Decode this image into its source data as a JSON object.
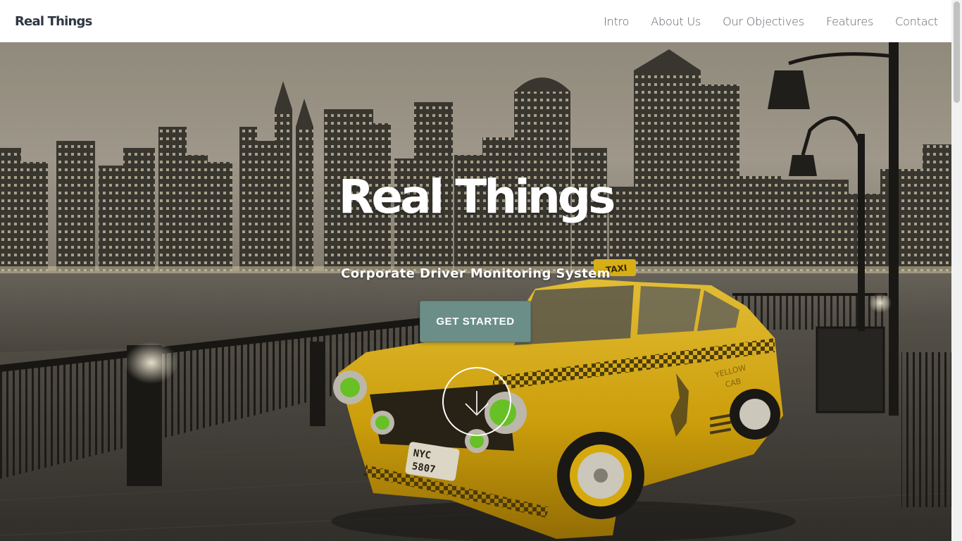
{
  "header": {
    "brand": "Real Things",
    "nav": [
      {
        "label": "Intro"
      },
      {
        "label": "About Us"
      },
      {
        "label": "Our Objectives"
      },
      {
        "label": "Features"
      },
      {
        "label": "Contact"
      }
    ]
  },
  "hero": {
    "title": "Real Things",
    "subtitle": "Corporate Driver Monitoring System",
    "cta_label": "GET STARTED",
    "scroll_icon": "arrow-down-icon",
    "image_text": {
      "taxi_sign": "TAXI",
      "plate_line1": "NYC",
      "plate_line2": "5807",
      "door_line1": "YELLOW",
      "door_line2": "CAB"
    }
  },
  "colors": {
    "cta_background": "#6b8e89",
    "taxi_yellow": "#e3b40f",
    "headlight_green": "#6fcc2a",
    "brand_text": "#2f3742",
    "nav_text": "#5b6068"
  }
}
